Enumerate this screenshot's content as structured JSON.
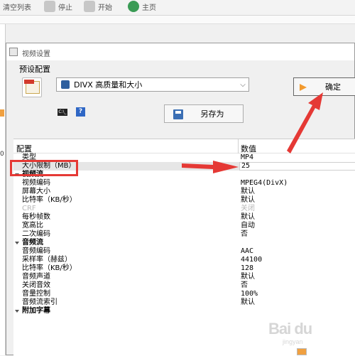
{
  "toolbar": {
    "clear_list": "清空列表",
    "stop": "停止",
    "start": "开始",
    "home": "主页"
  },
  "dialog": {
    "title": "视频设置",
    "preset_label": "预设配置",
    "preset_value": "DIVX 高质量和大小",
    "ok_label": "确定",
    "saveas_label": "另存为",
    "cmd_glyph": "C:\\_",
    "help_glyph": "?"
  },
  "grid": {
    "col_config": "配置",
    "col_value": "数值",
    "rows": [
      {
        "k": "类型",
        "v": "MP4",
        "kind": "item"
      },
      {
        "k": "大小限制（MB）",
        "v": "25",
        "kind": "item-selected"
      },
      {
        "k": "视频流",
        "v": "",
        "kind": "cat"
      },
      {
        "k": "视频编码",
        "v": "MPEG4(DivX)",
        "kind": "item"
      },
      {
        "k": "屏幕大小",
        "v": "默认",
        "kind": "item"
      },
      {
        "k": "比特率（KB/秒）",
        "v": "默认",
        "kind": "item"
      },
      {
        "k": "CRF",
        "v": "关闭",
        "kind": "item-disabled"
      },
      {
        "k": "每秒帧数",
        "v": "默认",
        "kind": "item"
      },
      {
        "k": "宽高比",
        "v": "自动",
        "kind": "item"
      },
      {
        "k": "二次编码",
        "v": "否",
        "kind": "item"
      },
      {
        "k": "音频流",
        "v": "",
        "kind": "cat"
      },
      {
        "k": "音频编码",
        "v": "AAC",
        "kind": "item"
      },
      {
        "k": "采样率（赫兹）",
        "v": "44100",
        "kind": "item"
      },
      {
        "k": "比特率（KB/秒）",
        "v": "128",
        "kind": "item"
      },
      {
        "k": "音频声道",
        "v": "默认",
        "kind": "item"
      },
      {
        "k": "关闭音效",
        "v": "否",
        "kind": "item"
      },
      {
        "k": "音量控制",
        "v": "100%",
        "kind": "item"
      },
      {
        "k": "音频流索引",
        "v": "默认",
        "kind": "item"
      },
      {
        "k": "附加字幕",
        "v": "",
        "kind": "cat"
      }
    ]
  },
  "left_strip": {
    "digit": "0"
  },
  "watermark": {
    "text": "Bai du",
    "sub": "jingyan"
  },
  "colors": {
    "highlight": "#e53935",
    "accent_orange": "#f29a2e",
    "selected_row": "#e6e6e6"
  }
}
